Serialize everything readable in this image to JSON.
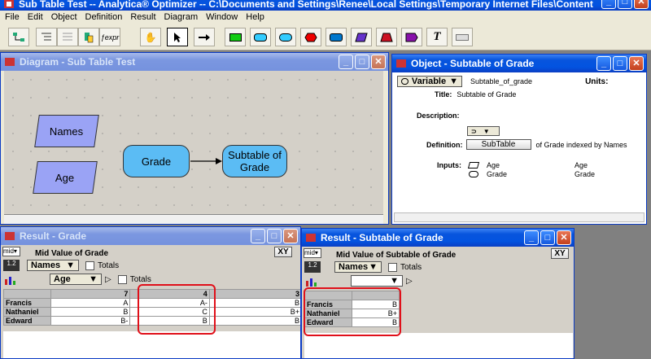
{
  "app": {
    "title": "Sub Table Test -- Analytica® Optimizer -- C:\\Documents and Settings\\Renee\\Local Settings\\Temporary Internet Files\\Content"
  },
  "menu": [
    "File",
    "Edit",
    "Object",
    "Definition",
    "Result",
    "Diagram",
    "Window",
    "Help"
  ],
  "toolbar": {
    "tools": [
      "diagram-icon",
      "outline-icon",
      "list-icon",
      "attributes-icon",
      "expression-icon",
      "browse-hand-icon",
      "arrow-pointer-icon",
      "connector-arrow-icon",
      "decision-icon",
      "chance-icon",
      "general-icon",
      "objective-icon",
      "index-icon",
      "constant-icon",
      "module-icon",
      "library-icon",
      "text-icon",
      "form-icon"
    ],
    "italic_t": "T",
    "expr_label": "ƒexpr"
  },
  "diagram": {
    "title": "Diagram - Sub Table Test",
    "nodes": {
      "names": "Names",
      "age": "Age",
      "grade": "Grade",
      "subtable": "Subtable of Grade"
    }
  },
  "object": {
    "title": "Object - Subtable of Grade",
    "class": "Variable",
    "identifier": "Subtable_of_grade",
    "units_label": "Units:",
    "title_label": "Title:",
    "title_value": "Subtable of Grade",
    "description_label": "Description:",
    "definition_label": "Definition:",
    "definition_button": "SubTable",
    "definition_text": "of Grade indexed by Names",
    "inputs_label": "Inputs:",
    "inputs": [
      {
        "name": "Age",
        "title": "Age"
      },
      {
        "name": "Grade",
        "title": "Grade"
      }
    ]
  },
  "result_grade": {
    "title": "Result - Grade",
    "heading": "Mid Value of Grade",
    "xy": "XY",
    "mid": "mid▾",
    "row_index": "Names",
    "col_index": "Age",
    "totals": "Totals",
    "columns": [
      "7",
      "4",
      "3"
    ],
    "rows": [
      {
        "name": "Francis",
        "values": [
          "A",
          "A-",
          "B"
        ]
      },
      {
        "name": "Nathaniel",
        "values": [
          "B",
          "C",
          "B+"
        ]
      },
      {
        "name": "Edward",
        "values": [
          "B-",
          "B",
          "B"
        ]
      }
    ]
  },
  "result_subtable": {
    "title": "Result - Subtable of Grade",
    "heading": "Mid Value of Subtable of Grade",
    "xy": "XY",
    "mid": "mid▾",
    "row_index": "Names",
    "totals": "Totals",
    "rows": [
      {
        "name": "Francis",
        "value": "B"
      },
      {
        "name": "Nathaniel",
        "value": "B+"
      },
      {
        "name": "Edward",
        "value": "B"
      }
    ]
  },
  "colors": {
    "variable_node": "#5bbcf4",
    "index_node": "#9aa3f5",
    "highlight": "#e0101a",
    "title_active": "#0353e0"
  }
}
